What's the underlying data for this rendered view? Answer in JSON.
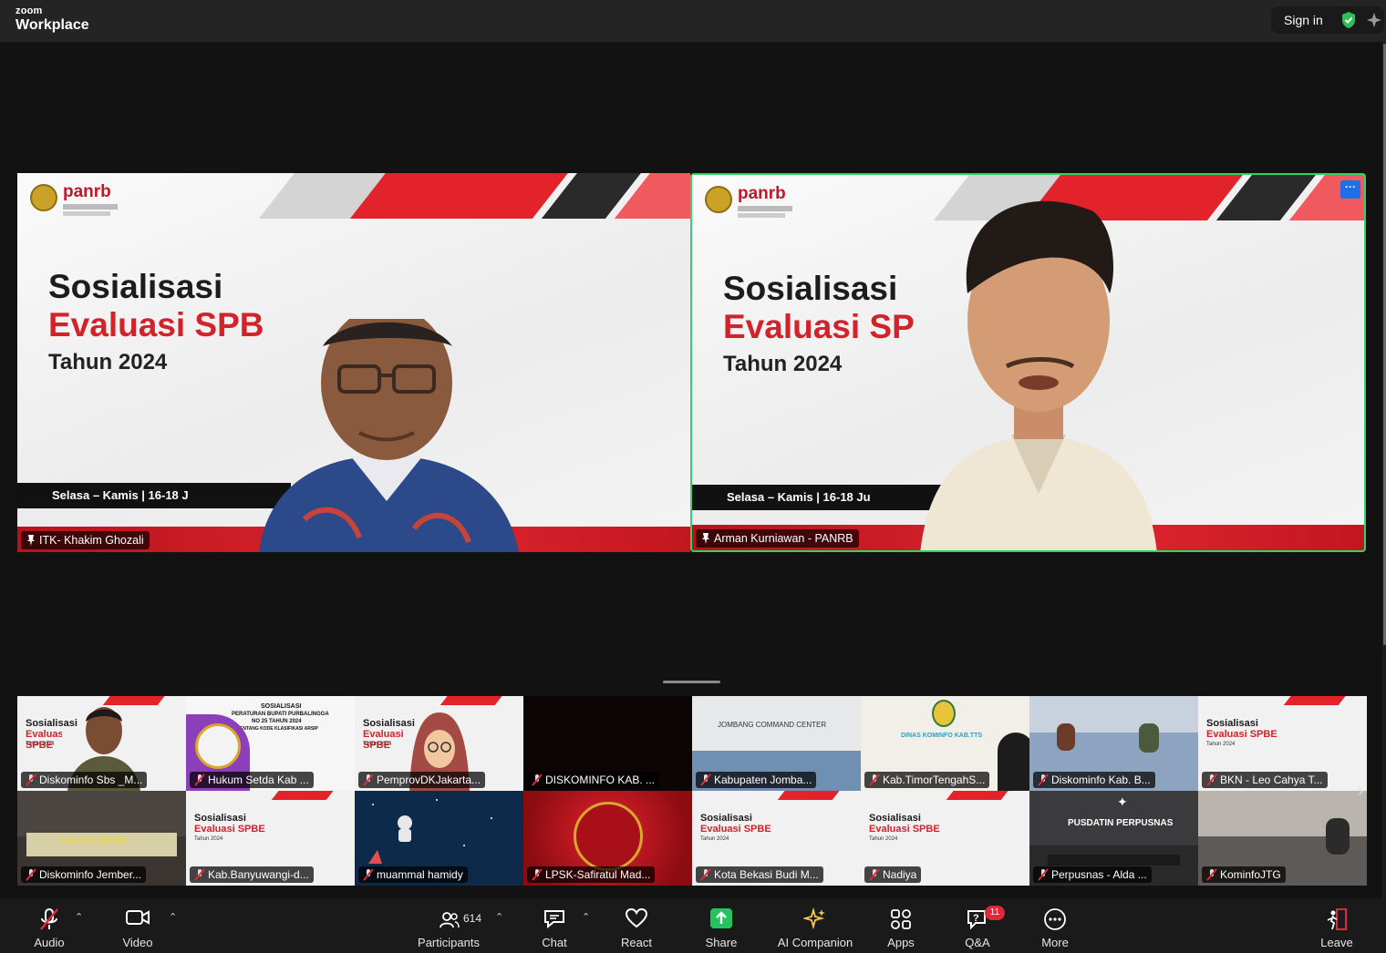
{
  "window": {
    "brand_small": "zoom",
    "brand_large": "Workplace",
    "sign_in": "Sign in"
  },
  "colors": {
    "active_speaker_border": "#2fd36b",
    "slide_red": "#d2232a",
    "toolbar_bg": "#1a1a1a",
    "share_green": "#23c45e",
    "badge_red": "#e0283a"
  },
  "main_tiles": [
    {
      "name": "ITK- Khakim Ghozali",
      "slide_logo": "panrb",
      "slide_title": "Sosialisasi",
      "slide_subtitle": "Evaluasi SPB",
      "slide_year": "Tahun 2024",
      "slide_date": "Selasa – Kamis | 16-18 J"
    },
    {
      "name": "Arman Kurniawan - PANRB",
      "slide_logo": "panrb",
      "slide_title": "Sosialisasi",
      "slide_subtitle": "Evaluasi SP",
      "slide_year": "Tahun 2024",
      "slide_date": "Selasa – Kamis | 16-18 Ju",
      "active": true,
      "more_icon": "more-dots-icon"
    }
  ],
  "gallery": {
    "row1": [
      {
        "name": "Diskominfo Sbs _M..."
      },
      {
        "name": "Hukum Setda Kab ..."
      },
      {
        "name": "PemprovDKJakarta..."
      },
      {
        "name": "DISKOMINFO KAB. ..."
      },
      {
        "name": "Kabupaten Jomba..."
      },
      {
        "name": "Kab.TimorTengahS..."
      },
      {
        "name": "Diskominfo Kab. B..."
      },
      {
        "name": "BKN - Leo Cahya T..."
      }
    ],
    "row2": [
      {
        "name": "Diskominfo Jember..."
      },
      {
        "name": "Kab.Banyuwangi-d..."
      },
      {
        "name": "muammal hamidy"
      },
      {
        "name": "LPSK-Safiratul Mad..."
      },
      {
        "name": "Kota Bekasi Budi M..."
      },
      {
        "name": "Nadiya"
      },
      {
        "name": "Perpusnas - Alda ..."
      },
      {
        "name": "KominfoJTG"
      }
    ],
    "tile_texts": {
      "slide_t1": "Sosialisasi",
      "slide_t2": "Evaluasi SPBE",
      "slide_t3": "Tahun 2024",
      "jombang": "JOMBANG COMMAND CENTER",
      "tts": "DINAS KOMINFO KAB.TTS",
      "pusdatin": "PUSDATIN PERPUSNAS",
      "hukum_l1": "SOSIALISASI",
      "hukum_l2": "PERATURAN BUPATI PURBALINGGA",
      "hukum_l3": "NO 25 TAHUN 2024",
      "hukum_l4": "TENTANG KODE KLASIFIKASI ARSIP",
      "jember": "KABUPATEN JEMBER"
    }
  },
  "toolbar": {
    "audio": "Audio",
    "video": "Video",
    "participants": "Participants",
    "participants_count": "614",
    "chat": "Chat",
    "react": "React",
    "share": "Share",
    "ai_companion": "AI Companion",
    "apps": "Apps",
    "qa": "Q&A",
    "qa_badge": "11",
    "more": "More",
    "leave": "Leave"
  }
}
